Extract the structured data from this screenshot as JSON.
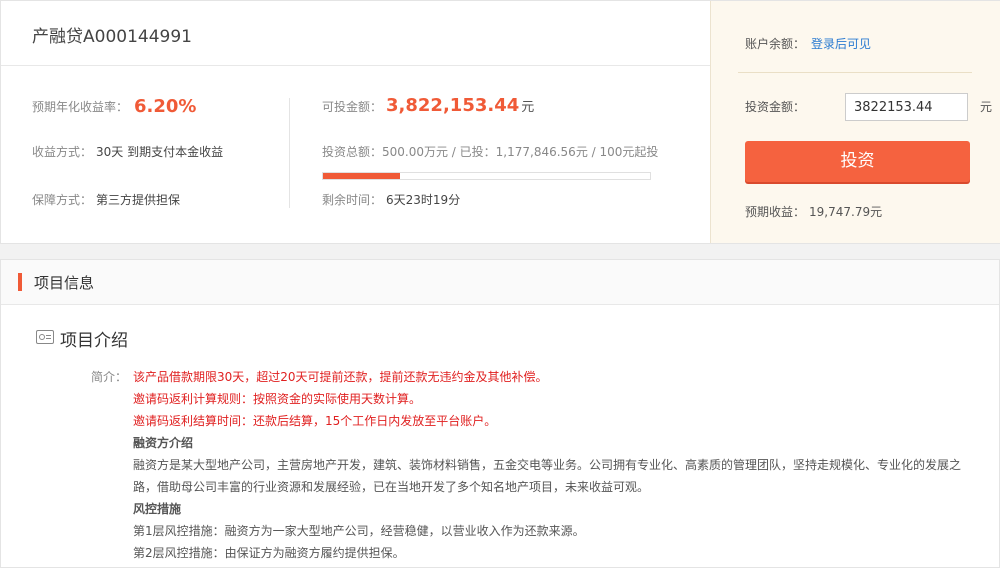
{
  "product": {
    "title": "产融贷A000144991",
    "rate_label": "预期年化收益率：",
    "rate_value": "6.20%",
    "method_label": "收益方式：",
    "method_value": "30天 到期支付本金收益",
    "guarantee_label": "保障方式：",
    "guarantee_value": "第三方提供担保",
    "available_label": "可投金额：",
    "available_value": "3,822,153.44",
    "available_unit": "元",
    "total_text": "投资总额：500.00万元 / 已投：1,177,846.56元 / 100元起投",
    "progress_fraction": 0.2356,
    "remaining_label": "剩余时间：",
    "remaining_value": "6天23时19分"
  },
  "invest_panel": {
    "balance_label": "账户余额：",
    "balance_link": "登录后可见",
    "amount_label": "投资金额：",
    "amount_value": "3822153.44",
    "amount_unit": "元",
    "button_label": "投资",
    "expected_label": "预期收益：",
    "expected_value": "19,747.79元"
  },
  "project_info": {
    "section_title": "项目信息",
    "intro_title": "项目介绍",
    "intro_label": "简介：",
    "red_lines": [
      "该产品借款期限30天，超过20天可提前还款，提前还款无违约金及其他补偿。",
      "邀请码返利计算规则：按照资金的实际使用天数计算。",
      "邀请码返利结算时间：还款后结算，15个工作日内发放至平台账户。"
    ],
    "borrower_heading": "融资方介绍",
    "borrower_text": "融资方是某大型地产公司，主营房地产开发，建筑、装饰材料销售，五金交电等业务。公司拥有专业化、高素质的管理团队，坚持走规模化、专业化的发展之路，借助母公司丰富的行业资源和发展经验，已在当地开发了多个知名地产项目，未来收益可观。",
    "risk_heading": "风控措施",
    "risk_lines": [
      "第1层风控措施：融资方为一家大型地产公司，经营稳健，以营业收入作为还款来源。",
      "第2层风控措施：由保证方为融资方履约提供担保。"
    ]
  },
  "colors": {
    "accent": "#f05a37",
    "link": "#2b7bd1",
    "panel_bg": "#fdf8ee"
  }
}
